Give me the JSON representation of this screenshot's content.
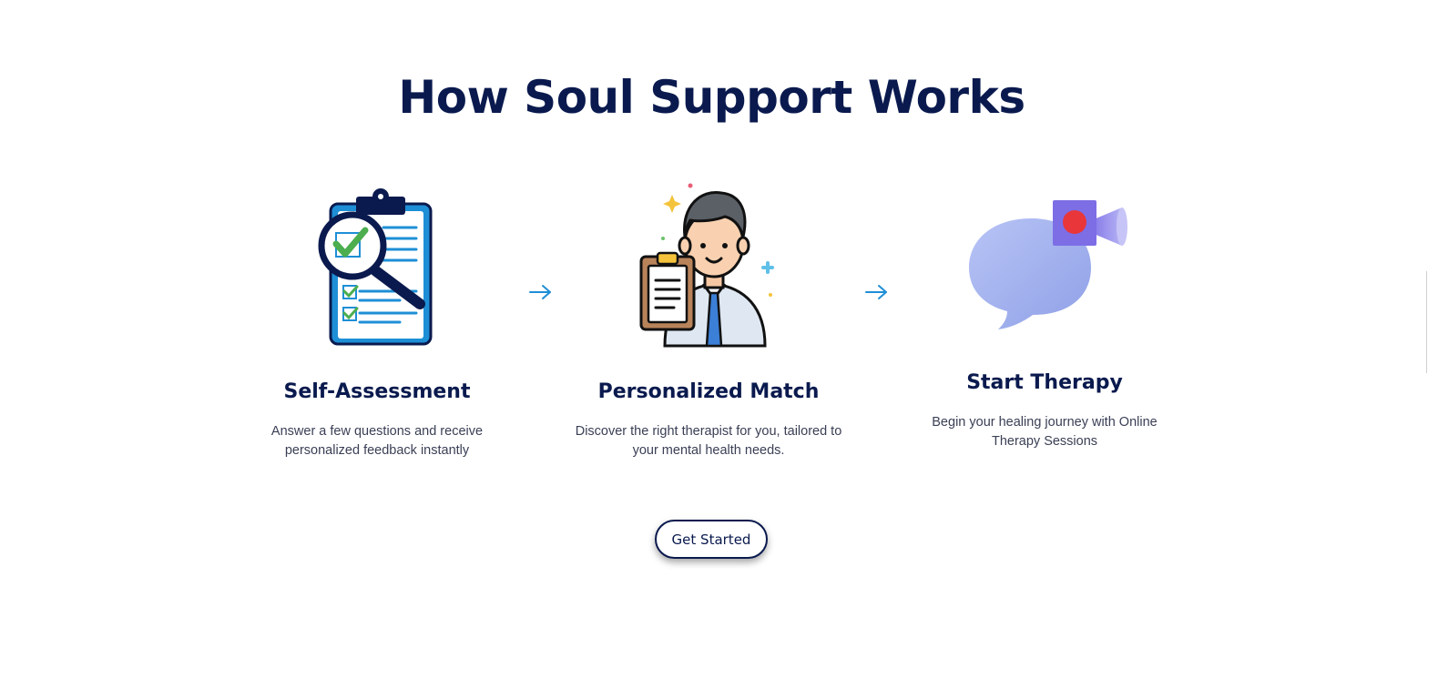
{
  "section": {
    "title": "How Soul Support Works"
  },
  "steps": [
    {
      "icon": "clipboard-magnifier-icon",
      "title": "Self-Assessment",
      "description": "Answer a few questions and receive personalized feedback instantly"
    },
    {
      "icon": "doctor-with-clipboard-icon",
      "title": "Personalized Match",
      "description": "Discover the right therapist for you, tailored to your mental health needs."
    },
    {
      "icon": "chat-bubble-video-camera-icon",
      "title": "Start Therapy",
      "description": "Begin your healing journey with Online Therapy Sessions"
    }
  ],
  "cta": {
    "label": "Get Started"
  },
  "colors": {
    "heading": "#0a1a4e",
    "arrow": "#1e8fd6",
    "body_text": "#3a3f55",
    "bubble": "#a8b6f0",
    "camera": "#7d6ee6",
    "record_dot": "#e8363a"
  }
}
